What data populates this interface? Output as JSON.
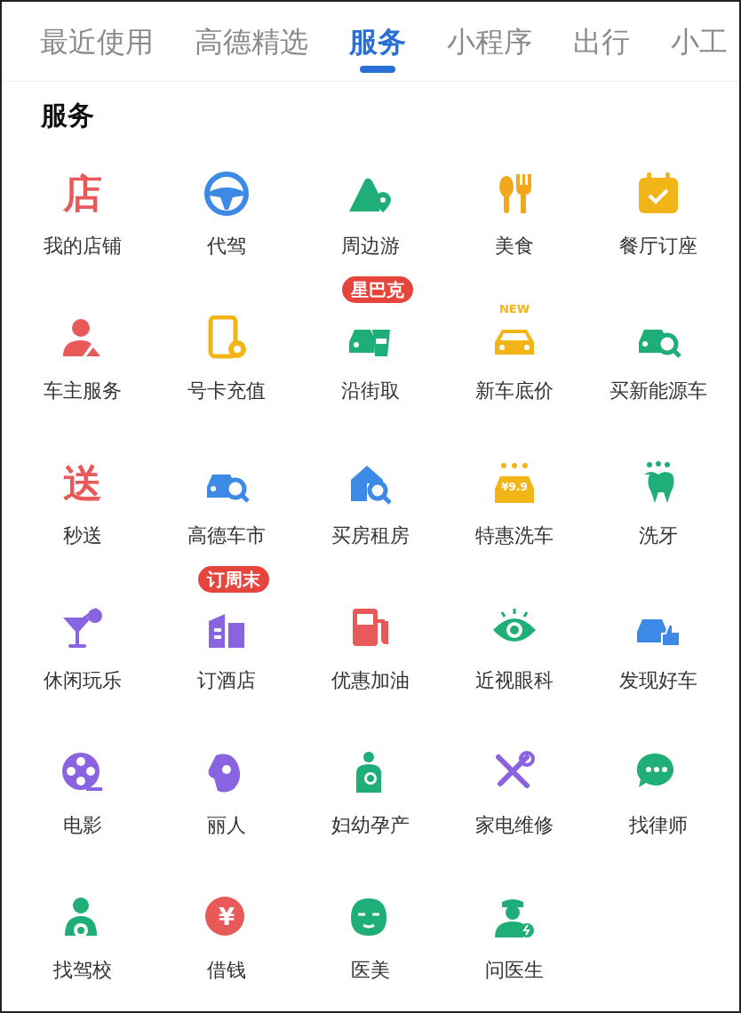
{
  "tabs": [
    {
      "label": "最近使用",
      "selected": false
    },
    {
      "label": "高德精选",
      "selected": false
    },
    {
      "label": "服务",
      "selected": true
    },
    {
      "label": "小程序",
      "selected": false
    },
    {
      "label": "出行",
      "selected": false
    },
    {
      "label": "小工",
      "selected": false
    }
  ],
  "section": {
    "title": "服务",
    "items": [
      {
        "label": "我的店铺",
        "kind": "glyph",
        "icon_text": "店",
        "color": "#e8595a"
      },
      {
        "label": "代驾",
        "kind": "wheel",
        "color": "#3d8ae6"
      },
      {
        "label": "周边游",
        "kind": "hill",
        "color": "#1fae78"
      },
      {
        "label": "美食",
        "kind": "cutlery",
        "color": "#f2a81d"
      },
      {
        "label": "餐厅订座",
        "kind": "calendar",
        "color": "#f2b518"
      },
      {
        "label": "车主服务",
        "kind": "person",
        "color": "#e8595a"
      },
      {
        "label": "号卡充值",
        "kind": "phone",
        "color": "#f2b518"
      },
      {
        "label": "沿街取",
        "kind": "carcup",
        "color": "#1fae78",
        "badge": "星巴克"
      },
      {
        "label": "新车底价",
        "kind": "car",
        "icon_text": "NEW",
        "color": "#f2b518"
      },
      {
        "label": "买新能源车",
        "kind": "carsearch",
        "color": "#1fae78"
      },
      {
        "label": "秒送",
        "kind": "glyph",
        "icon_text": "送",
        "color": "#e8595a"
      },
      {
        "label": "高德车市",
        "kind": "carsearch",
        "color": "#3d8ae6"
      },
      {
        "label": "买房租房",
        "kind": "house",
        "color": "#3d8ae6"
      },
      {
        "label": "特惠洗车",
        "kind": "carwash",
        "icon_text": "¥9.9",
        "color": "#f2b518"
      },
      {
        "label": "洗牙",
        "kind": "tooth",
        "color": "#1fae78"
      },
      {
        "label": "休闲玩乐",
        "kind": "cocktail",
        "color": "#8a63e0"
      },
      {
        "label": "订酒店",
        "kind": "building",
        "color": "#8a63e0",
        "badge": "订周末"
      },
      {
        "label": "优惠加油",
        "kind": "pump",
        "color": "#e8595a"
      },
      {
        "label": "近视眼科",
        "kind": "eye",
        "color": "#1fae78"
      },
      {
        "label": "发现好车",
        "kind": "carthumb",
        "color": "#3d8ae6"
      },
      {
        "label": "电影",
        "kind": "film",
        "color": "#8a63e0"
      },
      {
        "label": "丽人",
        "kind": "profile",
        "color": "#8a63e0"
      },
      {
        "label": "妇幼孕产",
        "kind": "mother",
        "color": "#1fae78"
      },
      {
        "label": "家电维修",
        "kind": "tools",
        "color": "#8a63e0"
      },
      {
        "label": "找律师",
        "kind": "chat",
        "color": "#1fae78"
      },
      {
        "label": "找驾校",
        "kind": "driver",
        "color": "#1fae78"
      },
      {
        "label": "借钱",
        "kind": "coin",
        "icon_text": "¥",
        "color": "#e8595a"
      },
      {
        "label": "医美",
        "kind": "mask",
        "color": "#1fae78"
      },
      {
        "label": "问医生",
        "kind": "doctor",
        "color": "#1fae78"
      }
    ]
  }
}
